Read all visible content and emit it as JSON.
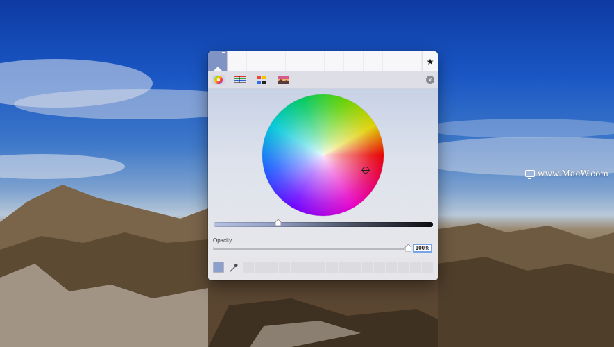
{
  "desktop": {
    "watermark": "www.MacW.com"
  },
  "color_panel": {
    "favorites_button": "★",
    "close_button": "×",
    "modes": [
      "color-wheel-icon",
      "color-sliders-icon",
      "color-palettes-icon",
      "image-palettes-icon"
    ],
    "opacity": {
      "label": "Opacity",
      "value": "100%",
      "level": 1.0
    },
    "brightness_level": 0.29,
    "current_color": "#7f93c4",
    "accent_color": "#78a4e8"
  }
}
